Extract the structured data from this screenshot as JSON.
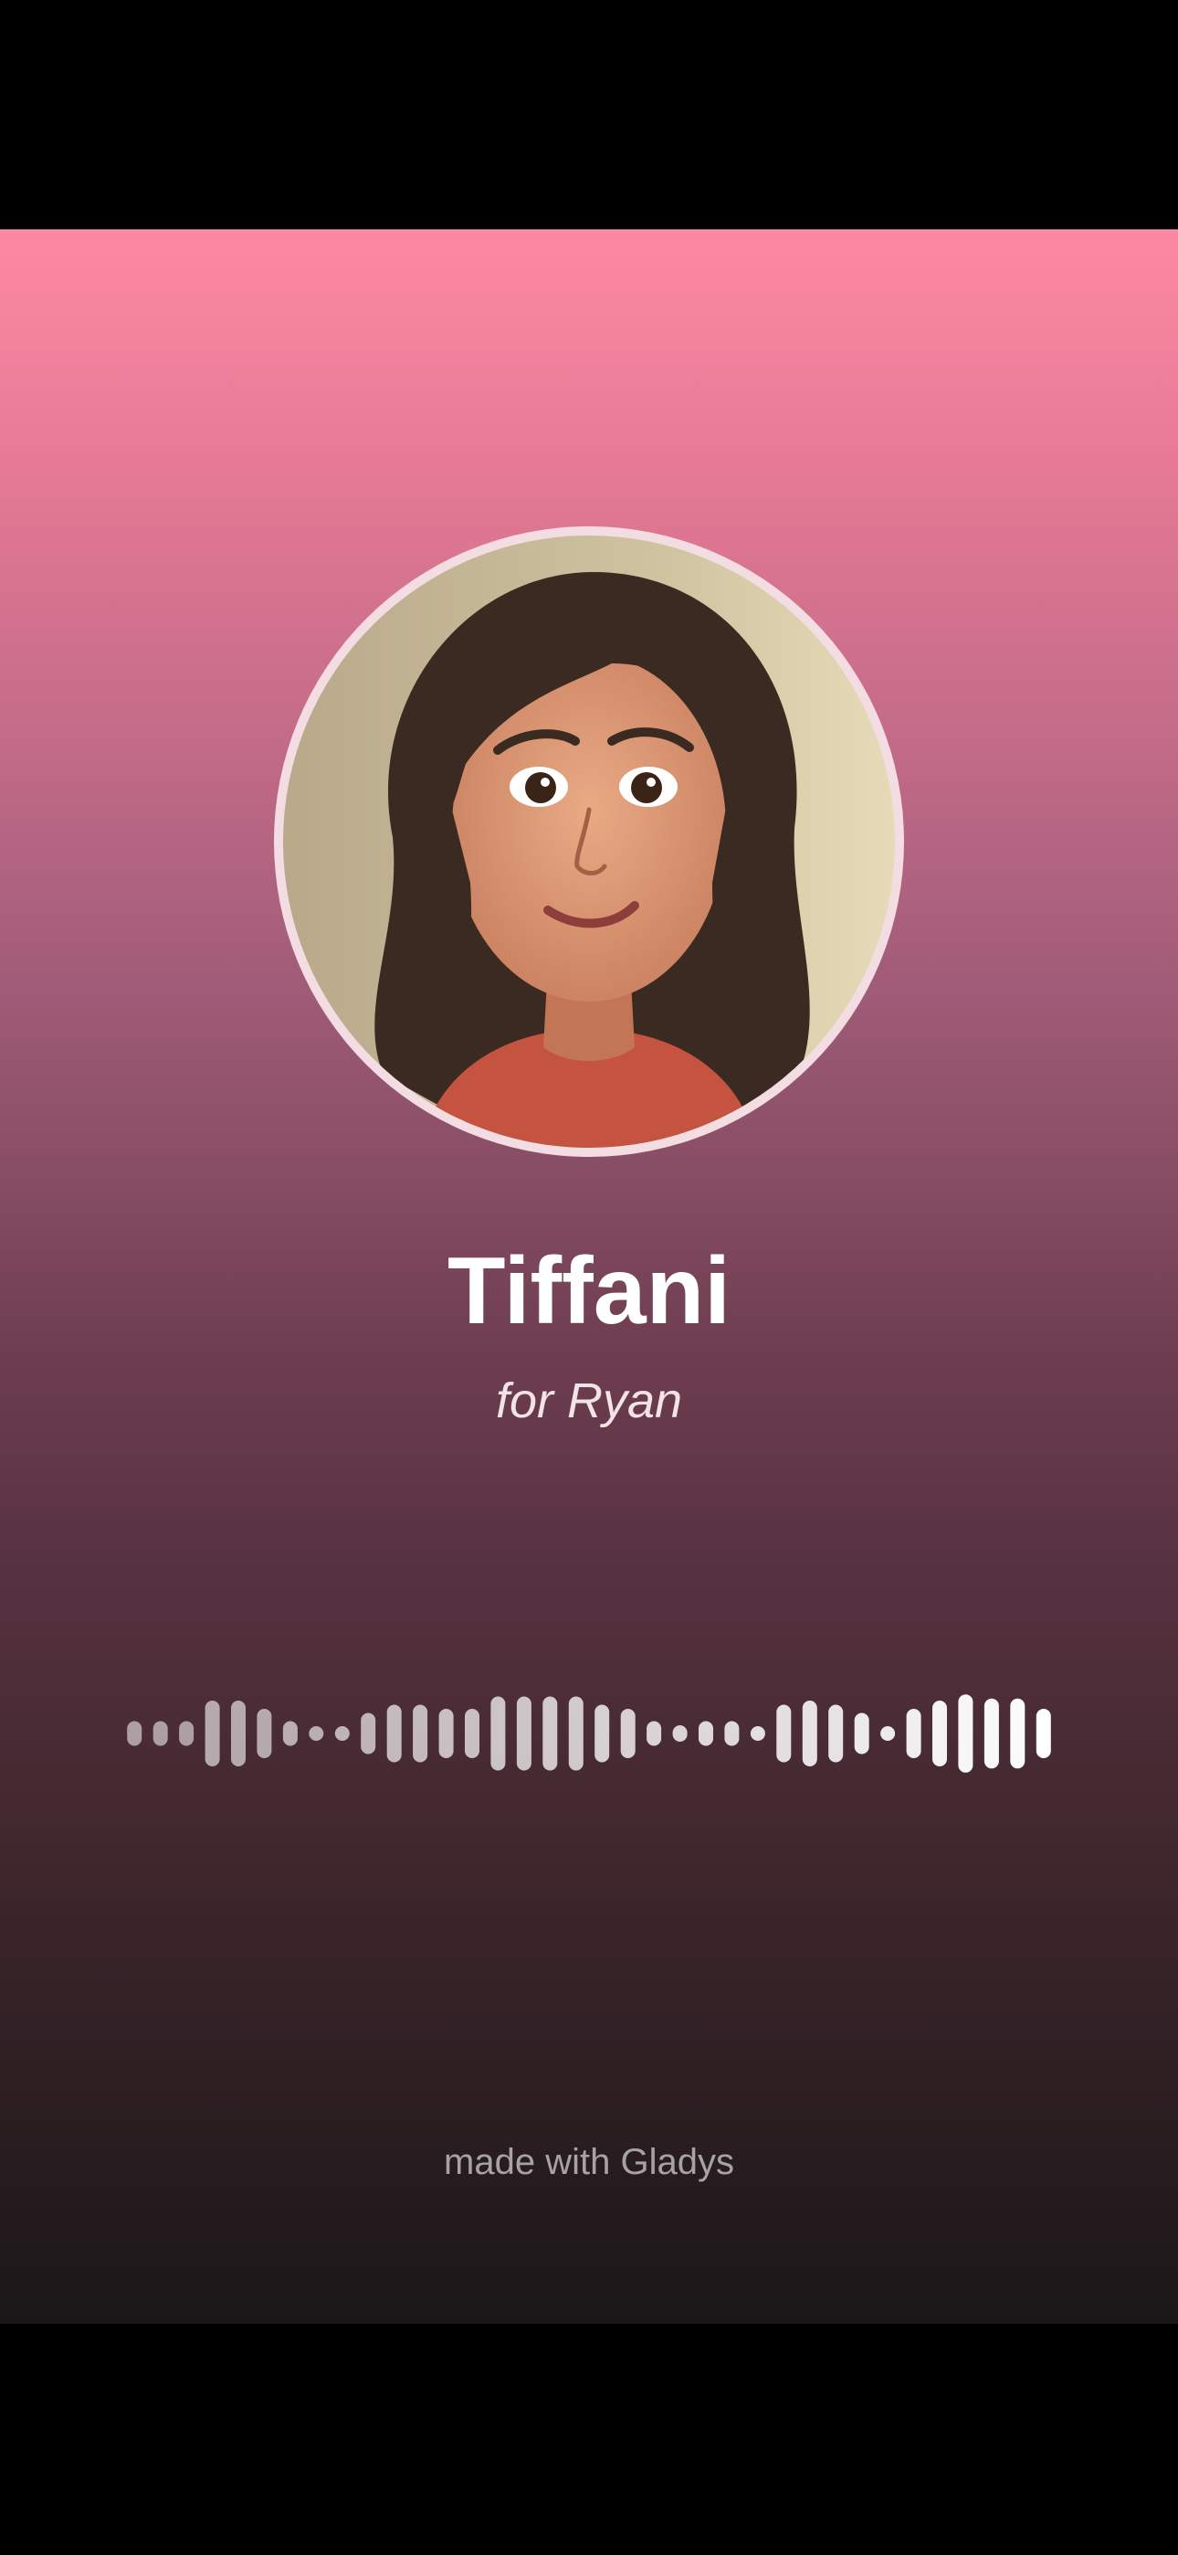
{
  "profile": {
    "name": "Tiffani",
    "subtitle": "for Ryan"
  },
  "footer": {
    "text": "made with Gladys"
  },
  "colors": {
    "gradient_top": "#fd89a4",
    "gradient_bottom": "#1b1718",
    "avatar_ring": "#f3dde3",
    "waveform_bar": "#ffffff"
  },
  "waveform": {
    "bar_levels": [
      0.3,
      0.3,
      0.3,
      0.8,
      0.8,
      0.6,
      0.3,
      0.1,
      0.1,
      0.5,
      0.7,
      0.7,
      0.6,
      0.6,
      0.9,
      0.9,
      0.9,
      0.9,
      0.7,
      0.6,
      0.3,
      0.2,
      0.3,
      0.3,
      0.1,
      0.7,
      0.8,
      0.7,
      0.5,
      0.1,
      0.6,
      0.8,
      0.95,
      0.85,
      0.85,
      0.6
    ],
    "bar_opacity": [
      0.55,
      0.55,
      0.55,
      0.6,
      0.6,
      0.6,
      0.62,
      0.62,
      0.65,
      0.65,
      0.68,
      0.68,
      0.7,
      0.7,
      0.72,
      0.72,
      0.75,
      0.75,
      0.78,
      0.78,
      0.8,
      0.8,
      0.82,
      0.82,
      0.85,
      0.85,
      0.87,
      0.87,
      0.9,
      0.9,
      0.92,
      0.94,
      0.96,
      0.97,
      0.98,
      1.0
    ]
  },
  "icons": {
    "avatar": "illustrated-portrait"
  }
}
